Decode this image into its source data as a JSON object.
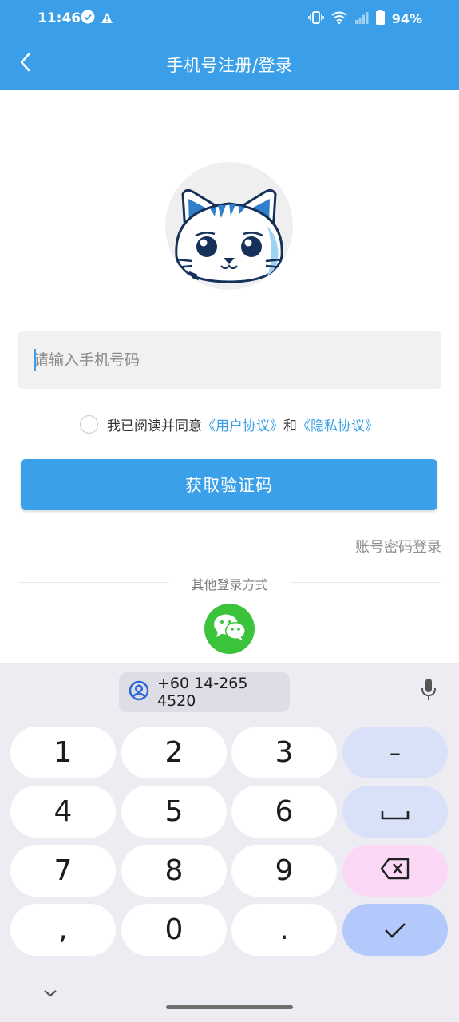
{
  "status_bar": {
    "time": "11:46",
    "battery": "94%"
  },
  "header": {
    "title": "手机号注册/登录"
  },
  "form": {
    "phone_placeholder": "请输入手机号码",
    "agree_prefix": "我已阅读并同意",
    "user_agreement": "《用户协议》",
    "and": "和",
    "privacy_agreement": "《隐私协议》",
    "get_code_label": "获取验证码",
    "account_login": "账号密码登录",
    "other_login": "其他登录方式"
  },
  "keyboard": {
    "suggestion": "+60 14-265 4520",
    "rows": [
      [
        "1",
        "2",
        "3",
        "–"
      ],
      [
        "4",
        "5",
        "6",
        "␣"
      ],
      [
        "7",
        "8",
        "9",
        "⌫"
      ],
      [
        ",",
        "0",
        ".",
        "✓"
      ]
    ]
  },
  "colors": {
    "primary": "#3a9fe8",
    "wechat": "#3bc33b",
    "keyboard_bg": "#eeecf3"
  }
}
